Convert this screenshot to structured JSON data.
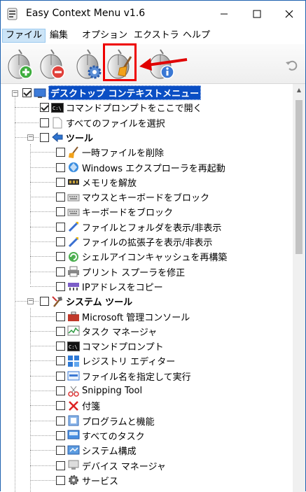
{
  "window": {
    "title": "Easy Context Menu v1.6"
  },
  "menubar": [
    {
      "label": "ファイル",
      "active": true
    },
    {
      "label": "編集",
      "active": false
    },
    {
      "label": "オプション",
      "active": false
    },
    {
      "label": "エクストラ",
      "active": false
    },
    {
      "label": "ヘルプ",
      "active": false
    }
  ],
  "toolbar": {
    "buttons": [
      {
        "name": "add-menu-item-button",
        "icon": "mouse-plus-icon"
      },
      {
        "name": "remove-menu-item-button",
        "icon": "mouse-minus-icon"
      },
      {
        "name": "settings-button",
        "icon": "mouse-gear-icon"
      },
      {
        "name": "cleaner-button",
        "icon": "mouse-broom-icon"
      },
      {
        "name": "info-button",
        "icon": "mouse-info-icon"
      },
      {
        "name": "undo-button",
        "icon": "undo-icon"
      }
    ],
    "highlight_color": "#e00000"
  },
  "tree": {
    "root": {
      "label": "デスクトップ コンテキストメニュー",
      "checked": true,
      "selected": true
    },
    "items": [
      {
        "label": "コマンドプロンプトをここで開く",
        "checked": true,
        "icon": "cmd-icon",
        "level": 1
      },
      {
        "label": "すべてのファイルを選択",
        "checked": false,
        "icon": "blank-file-icon",
        "level": 1
      },
      {
        "label": "ツール",
        "checked": false,
        "icon": "tools-arrow-icon",
        "level": 1,
        "bold": true,
        "group": true
      },
      {
        "label": "一時ファイルを削除",
        "checked": false,
        "icon": "broom-icon",
        "level": 2
      },
      {
        "label": "Windows エクスプローラを再起動",
        "checked": false,
        "icon": "explorer-icon",
        "level": 2
      },
      {
        "label": "メモリを解放",
        "checked": false,
        "icon": "memory-icon",
        "level": 2
      },
      {
        "label": "マウスとキーボードをブロック",
        "checked": false,
        "icon": "keyboard-mouse-icon",
        "level": 2
      },
      {
        "label": "キーボードをブロック",
        "checked": false,
        "icon": "keyboard-icon",
        "level": 2
      },
      {
        "label": "ファイルとフォルダを表示/非表示",
        "checked": false,
        "icon": "wand-icon",
        "level": 2
      },
      {
        "label": "ファイルの拡張子を表示/非表示",
        "checked": false,
        "icon": "wand-icon",
        "level": 2
      },
      {
        "label": "シェルアイコンキャッシュを再構築",
        "checked": false,
        "icon": "refresh-icon",
        "level": 2
      },
      {
        "label": "プリント スプーラを修正",
        "checked": false,
        "icon": "printer-icon",
        "level": 2
      },
      {
        "label": "IPアドレスをコピー",
        "checked": false,
        "icon": "network-icon",
        "level": 2
      },
      {
        "label": "システム ツール",
        "checked": false,
        "icon": "hammer-icon",
        "level": 1,
        "bold": true,
        "group": true
      },
      {
        "label": "Microsoft 管理コンソール",
        "checked": false,
        "icon": "toolbox-icon",
        "level": 2
      },
      {
        "label": "タスク マネージャ",
        "checked": false,
        "icon": "taskmgr-icon",
        "level": 2
      },
      {
        "label": "コマンドプロンプト",
        "checked": false,
        "icon": "cmd-icon",
        "level": 2
      },
      {
        "label": "レジストリ エディター",
        "checked": false,
        "icon": "registry-icon",
        "level": 2
      },
      {
        "label": "ファイル名を指定して実行",
        "checked": false,
        "icon": "run-icon",
        "level": 2
      },
      {
        "label": "Snipping Tool",
        "checked": false,
        "icon": "scissors-icon",
        "level": 2
      },
      {
        "label": "付箋",
        "checked": false,
        "icon": "x-mark-icon",
        "level": 2
      },
      {
        "label": "プログラムと機能",
        "checked": false,
        "icon": "programs-icon",
        "level": 2
      },
      {
        "label": "すべてのタスク",
        "checked": false,
        "icon": "control-panel-icon",
        "level": 2
      },
      {
        "label": "システム構成",
        "checked": false,
        "icon": "msconfig-icon",
        "level": 2
      },
      {
        "label": "デバイス マネージャ",
        "checked": false,
        "icon": "device-icon",
        "level": 2
      },
      {
        "label": "サービス",
        "checked": false,
        "icon": "services-icon",
        "level": 2
      }
    ]
  }
}
